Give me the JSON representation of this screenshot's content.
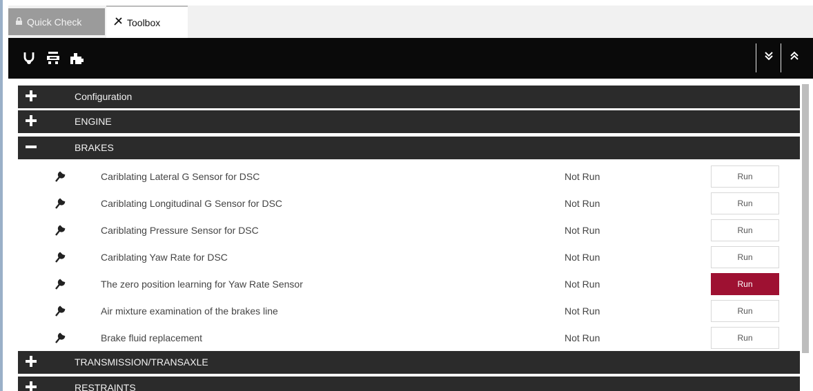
{
  "tabs": [
    {
      "label": "Quick Check",
      "icon": "lock-icon",
      "active": false
    },
    {
      "label": "Toolbox",
      "icon": "tools-icon",
      "active": true
    }
  ],
  "toolbar": {
    "left_icons": [
      "stethoscope-icon",
      "car-icon",
      "puzzle-icon"
    ],
    "right_icons": [
      "double-chevron-down-icon",
      "double-chevron-up-icon"
    ]
  },
  "sections": [
    {
      "label": "Configuration",
      "expanded": false
    },
    {
      "label": "ENGINE",
      "expanded": false
    },
    {
      "label": "BRAKES",
      "expanded": true
    },
    {
      "label": "TRANSMISSION/TRANSAXLE",
      "expanded": false
    },
    {
      "label": "RESTRAINTS",
      "expanded": false
    }
  ],
  "brakes_items": [
    {
      "label": "Cariblating Lateral G Sensor for DSC",
      "status": "Not Run",
      "button": "Run",
      "highlighted": false
    },
    {
      "label": "Cariblating Longitudinal G Sensor for DSC",
      "status": "Not Run",
      "button": "Run",
      "highlighted": false
    },
    {
      "label": "Cariblating Pressure Sensor for DSC",
      "status": "Not Run",
      "button": "Run",
      "highlighted": false
    },
    {
      "label": "Cariblating Yaw Rate for DSC",
      "status": "Not Run",
      "button": "Run",
      "highlighted": false
    },
    {
      "label": "The zero position learning for Yaw Rate Sensor",
      "status": "Not Run",
      "button": "Run",
      "highlighted": true
    },
    {
      "label": "Air mixture examination of the brakes line",
      "status": "Not Run",
      "button": "Run",
      "highlighted": false
    },
    {
      "label": "Brake fluid replacement",
      "status": "Not Run",
      "button": "Run",
      "highlighted": false
    }
  ],
  "colors": {
    "toolbar_bg": "#0a0a0a",
    "section_bg": "#2b2b2b",
    "run_highlight": "#9e1132"
  }
}
